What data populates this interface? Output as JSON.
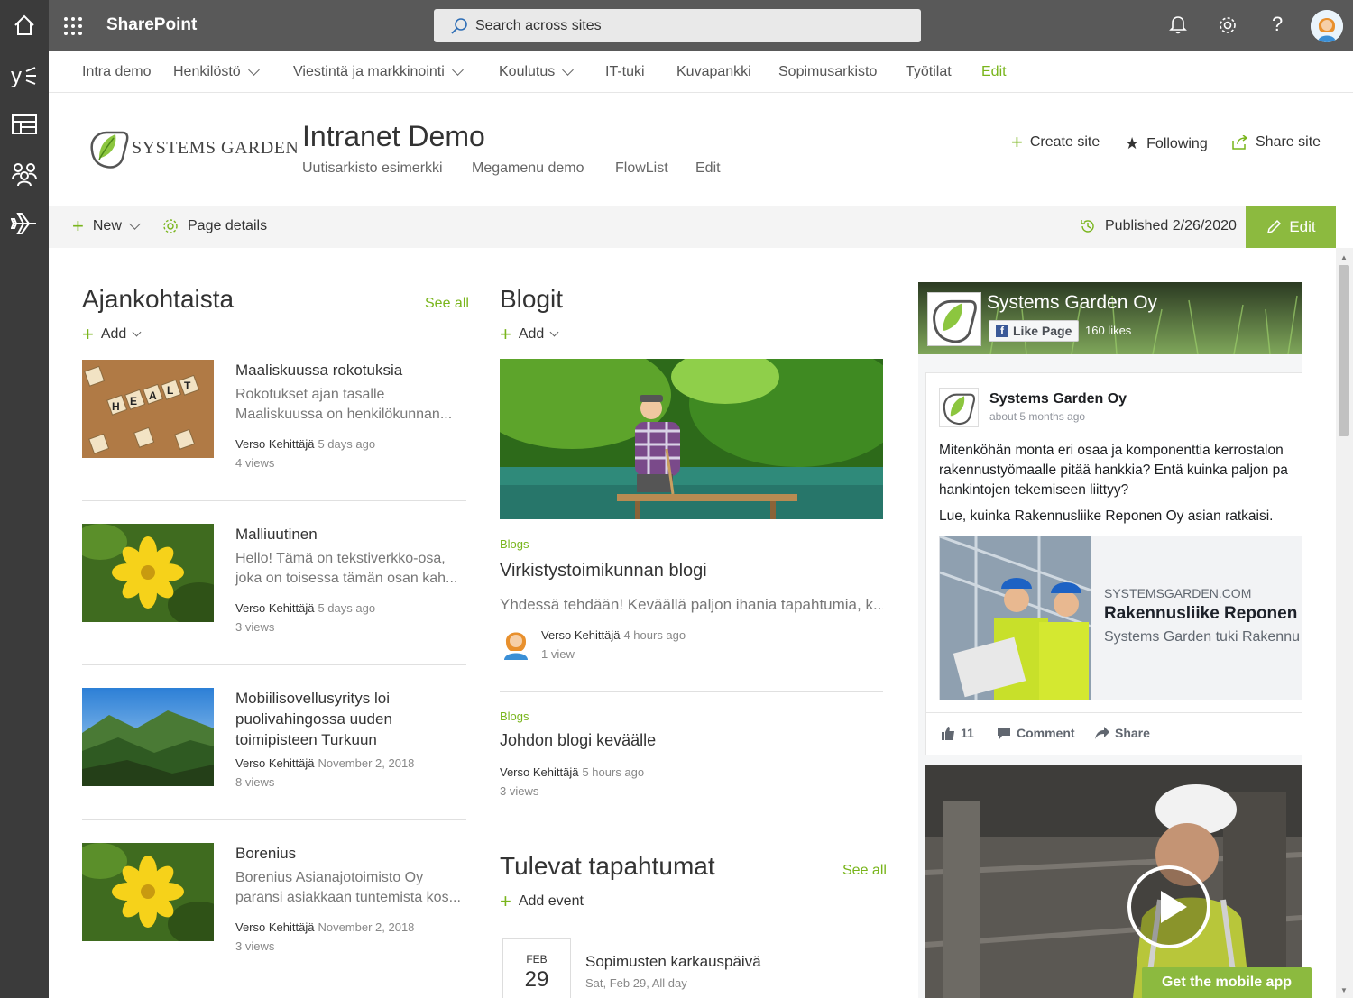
{
  "suite": {
    "brand": "SharePoint",
    "search_placeholder": "Search across sites"
  },
  "topnav": [
    {
      "label": "Intra demo"
    },
    {
      "label": "Henkilöstö"
    },
    {
      "label": "Viestintä ja markkinointi"
    },
    {
      "label": "Koulutus"
    },
    {
      "label": "IT-tuki"
    },
    {
      "label": "Kuvapankki"
    },
    {
      "label": "Sopimusarkisto"
    },
    {
      "label": "Työtilat"
    },
    {
      "label": "Edit"
    }
  ],
  "site": {
    "logo_text": "SYSTEMS GARDEN",
    "title": "Intranet Demo",
    "sublinks": [
      "Uutisarkisto esimerkki",
      "Megamenu demo",
      "FlowList",
      "Edit"
    ],
    "create_site": "Create site",
    "following": "Following",
    "share_site": "Share site"
  },
  "cmdbar": {
    "new": "New",
    "page_details": "Page details",
    "published": "Published 2/26/2020",
    "edit": "Edit"
  },
  "news": {
    "title": "Ajankohtaista",
    "see_all": "See all",
    "add": "Add",
    "items": [
      {
        "title": "Maaliskuussa rokotuksia",
        "desc": "Rokotukset ajan tasalle Maaliskuussa on henkilökunnan...",
        "author": "Verso Kehittäjä",
        "date": "5 days ago",
        "views": "4 views"
      },
      {
        "title": "Malliuutinen",
        "desc": "Hello! Tämä on tekstiverkko-osa, joka on toisessa tämän osan kah...",
        "author": "Verso Kehittäjä",
        "date": "5 days ago",
        "views": "3 views"
      },
      {
        "title": "Mobiilisovellusyritys loi puolivahingossa uuden toimipisteen Turkuun",
        "author": "Verso Kehittäjä",
        "date": "November 2, 2018",
        "views": "8 views"
      },
      {
        "title": "Borenius",
        "desc": "Borenius Asianajotoimisto Oy paransi asiakkaan tuntemista kos...",
        "author": "Verso Kehittäjä",
        "date": "November 2, 2018",
        "views": "3 views"
      }
    ]
  },
  "blogs": {
    "title": "Blogit",
    "add": "Add",
    "items": [
      {
        "tag": "Blogs",
        "title": "Virkistystoimikunnan blogi",
        "desc": "Yhdessä tehdään! Keväällä paljon ihania tapahtumia, k...",
        "author": "Verso Kehittäjä",
        "date": "4 hours ago",
        "views": "1 view"
      },
      {
        "tag": "Blogs",
        "title": "Johdon blogi keväälle",
        "author": "Verso Kehittäjä",
        "date": "5 hours ago",
        "views": "3 views"
      }
    ]
  },
  "events": {
    "title": "Tulevat tapahtumat",
    "see_all": "See all",
    "add": "Add event",
    "items": [
      {
        "month": "FEB",
        "day": "29",
        "title": "Sopimusten karkauspäivä",
        "when": "Sat, Feb 29, All day"
      }
    ]
  },
  "facebook": {
    "page_name": "Systems Garden Oy",
    "like_page": "Like Page",
    "likes": "160 likes",
    "post_author": "Systems Garden Oy",
    "post_time": "about 5 months ago",
    "post_text1": "Mitenköhän monta eri osaa ja komponenttia kerrostalon rakennustyömaalle pitää hankkia? Entä kuinka paljon pa hankintojen tekemiseen liittyy?",
    "post_text2": "Lue, kuinka Rakennusliike Reponen Oy asian ratkaisi.",
    "link_domain": "SYSTEMSGARDEN.COM",
    "link_title": "Rakennusliike Reponen O",
    "link_desc": "Systems Garden tuki Rakennu",
    "like_count": "11",
    "comment": "Comment",
    "share": "Share",
    "mobile_app": "Get the mobile app"
  }
}
